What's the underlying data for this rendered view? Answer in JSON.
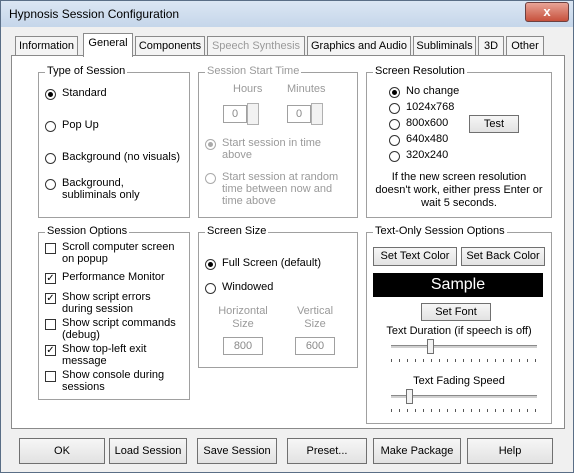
{
  "window": {
    "title": "Hypnosis Session Configuration",
    "close_glyph": "x"
  },
  "tabs": [
    {
      "label": "Information",
      "state": "normal"
    },
    {
      "label": "General",
      "state": "active"
    },
    {
      "label": "Components",
      "state": "normal"
    },
    {
      "label": "Speech Synthesis",
      "state": "disabled"
    },
    {
      "label": "Graphics and Audio",
      "state": "normal"
    },
    {
      "label": "Subliminals",
      "state": "normal"
    },
    {
      "label": "3D",
      "state": "normal"
    },
    {
      "label": "Other",
      "state": "normal"
    }
  ],
  "type_of_session": {
    "title": "Type of Session",
    "options": [
      "Standard",
      "Pop Up",
      "Background (no visuals)",
      "Background, subliminals only"
    ],
    "selected": "Standard"
  },
  "session_start_time": {
    "title": "Session Start Time",
    "hours_label": "Hours",
    "minutes_label": "Minutes",
    "hours_value": "0",
    "minutes_value": "0",
    "option_1": "Start session in time above",
    "option_2": "Start session at random time between now and time above"
  },
  "screen_resolution": {
    "title": "Screen Resolution",
    "options": [
      "No change",
      "1024x768",
      "800x600",
      "640x480",
      "320x240"
    ],
    "selected": "No change",
    "test_label": "Test",
    "note": "If the new screen resolution doesn't work, either press Enter or wait 5 seconds."
  },
  "session_options": {
    "title": "Session Options",
    "items": [
      {
        "label": "Scroll computer screen on popup",
        "checked": false
      },
      {
        "label": "Performance Monitor",
        "checked": true
      },
      {
        "label": "Show script errors during session",
        "checked": true
      },
      {
        "label": "Show script commands (debug)",
        "checked": false
      },
      {
        "label": "Show top-left exit message",
        "checked": true
      },
      {
        "label": "Show console during sessions",
        "checked": false
      }
    ]
  },
  "screen_size": {
    "title": "Screen Size",
    "options": [
      "Full Screen (default)",
      "Windowed"
    ],
    "selected": "Full Screen (default)",
    "horizontal_label": "Horizontal Size",
    "vertical_label": "Vertical Size",
    "horizontal_value": "800",
    "vertical_value": "600"
  },
  "text_only": {
    "title": "Text-Only Session Options",
    "set_text_color": "Set Text Color",
    "set_back_color": "Set Back Color",
    "sample": "Sample",
    "set_font": "Set Font",
    "duration_label": "Text Duration (if speech is off)",
    "fading_label": "Text Fading Speed",
    "duration_level": 0.27,
    "fading_level": 0.12
  },
  "bottom_buttons": [
    "OK",
    "Load Session",
    "Save Session",
    "Preset...",
    "Make Package",
    "Help"
  ],
  "colors": {
    "sample_bg": "#000000",
    "sample_fg": "#ffffff",
    "accent": "#c7513d"
  }
}
